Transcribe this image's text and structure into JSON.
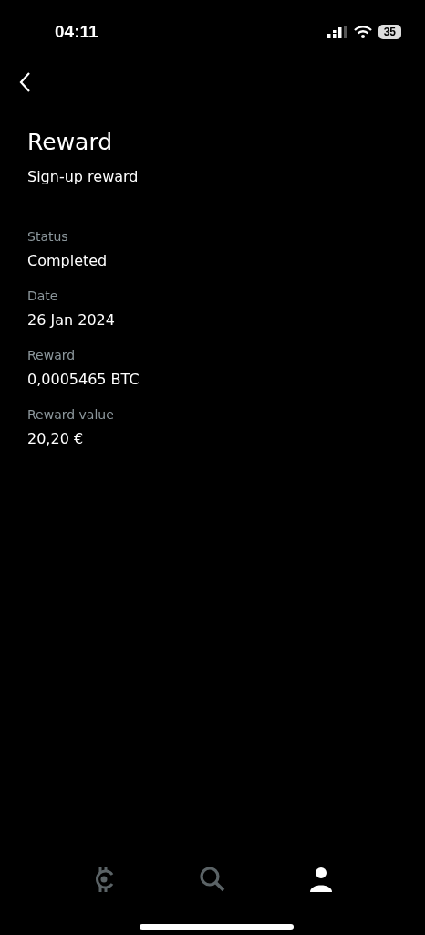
{
  "status_bar": {
    "time": "04:11",
    "battery": "35"
  },
  "title": "Reward",
  "subtitle": "Sign-up reward",
  "fields": [
    {
      "label": "Status",
      "value": "Completed"
    },
    {
      "label": "Date",
      "value": "26 Jan 2024"
    },
    {
      "label": "Reward",
      "value": "0,0005465 BTC"
    },
    {
      "label": "Reward value",
      "value": "20,20 €"
    }
  ],
  "tab_bar": [
    {
      "kind": "coin",
      "selected": false
    },
    {
      "kind": "search",
      "selected": false
    },
    {
      "kind": "profile",
      "selected": true
    }
  ]
}
